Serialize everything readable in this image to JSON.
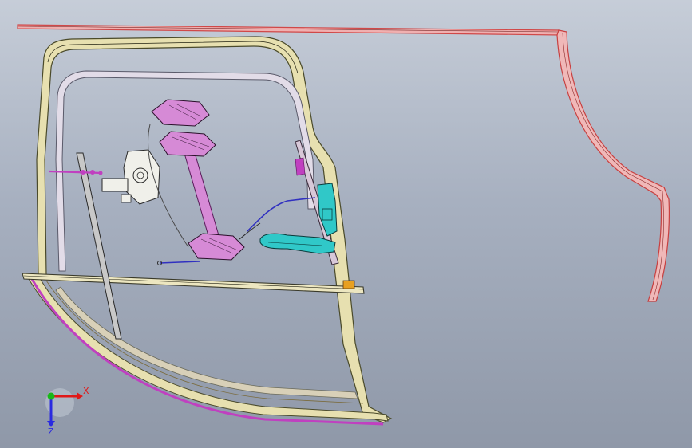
{
  "viewport": {
    "background_top": "#c6cdd8",
    "background_bottom": "#8f98a8"
  },
  "triad": {
    "x_label": "X",
    "z_label": "Z",
    "x_color": "#e01818",
    "y_color": "#18b818",
    "z_color": "#2a2ae0"
  },
  "colors": {
    "frame_outline": "#4a4a2a",
    "frame_fill": "#e7e0b0",
    "seal_magenta": "#c040c0",
    "regulator_pink": "#d68ad6",
    "motor_white": "#f0f0ea",
    "handle_cyan": "#30c8c8",
    "cable_blue": "#3030c0",
    "bracket_orange": "#e8a020",
    "panel_red": "#d04848",
    "panel_pink": "#f0b0b0"
  }
}
